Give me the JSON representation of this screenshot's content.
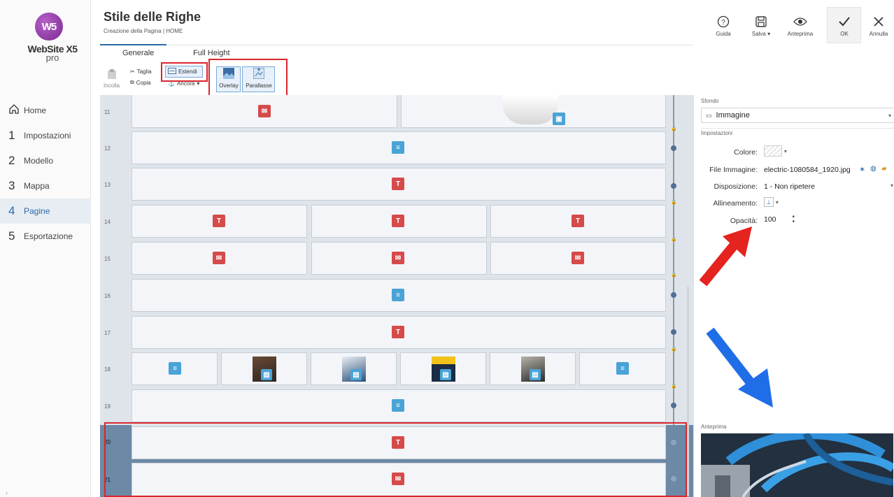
{
  "app": {
    "logo_text": "W5",
    "product_name": "WebSite X5",
    "product_edition": "pro"
  },
  "header": {
    "title": "Stile delle Righe",
    "breadcrumb": "Creazione della Pagina | HOME",
    "tabs": [
      "Generale",
      "Full Height"
    ],
    "active_tab": "Generale"
  },
  "toolbar": {
    "help": "Guida",
    "save": "Salva",
    "preview": "Anteprima",
    "ok": "OK",
    "cancel": "Annulla"
  },
  "ribbon": {
    "paste": "Incolla",
    "cut": "Taglia",
    "copy": "Copia",
    "stretch": "Estendi",
    "anchor": "Ancora",
    "overlay": "Overlay",
    "parallax": "Parallasse"
  },
  "sidebar": {
    "items": [
      {
        "num": "",
        "label": "Home",
        "icon": "home-icon"
      },
      {
        "num": "1",
        "label": "Impostazioni"
      },
      {
        "num": "2",
        "label": "Modello"
      },
      {
        "num": "3",
        "label": "Mappa"
      },
      {
        "num": "4",
        "label": "Pagine",
        "active": true
      },
      {
        "num": "5",
        "label": "Esportazione"
      }
    ]
  },
  "grid": {
    "rows": [
      "11",
      "12",
      "13",
      "14",
      "15",
      "16",
      "17",
      "18",
      "19",
      "20",
      "21"
    ],
    "selected_rows": [
      "20",
      "21"
    ]
  },
  "panel": {
    "background_label": "Sfondo",
    "background_type": "Immagine",
    "settings_label": "Impostazioni",
    "fields": {
      "color_label": "Colore:",
      "file_label": "File Immagine:",
      "file_value": "electric-1080584_1920.jpg",
      "layout_label": "Disposizione:",
      "layout_value": "1 - Non ripetere",
      "align_label": "Allineamento:",
      "opacity_label": "Opacità:",
      "opacity_value": "100"
    },
    "preview_label": "Anteprima"
  },
  "colors": {
    "accent": "#2b6aa7",
    "highlight_red": "#d9262c",
    "arrow_red": "#e5231f",
    "arrow_blue": "#1f6ee8"
  }
}
